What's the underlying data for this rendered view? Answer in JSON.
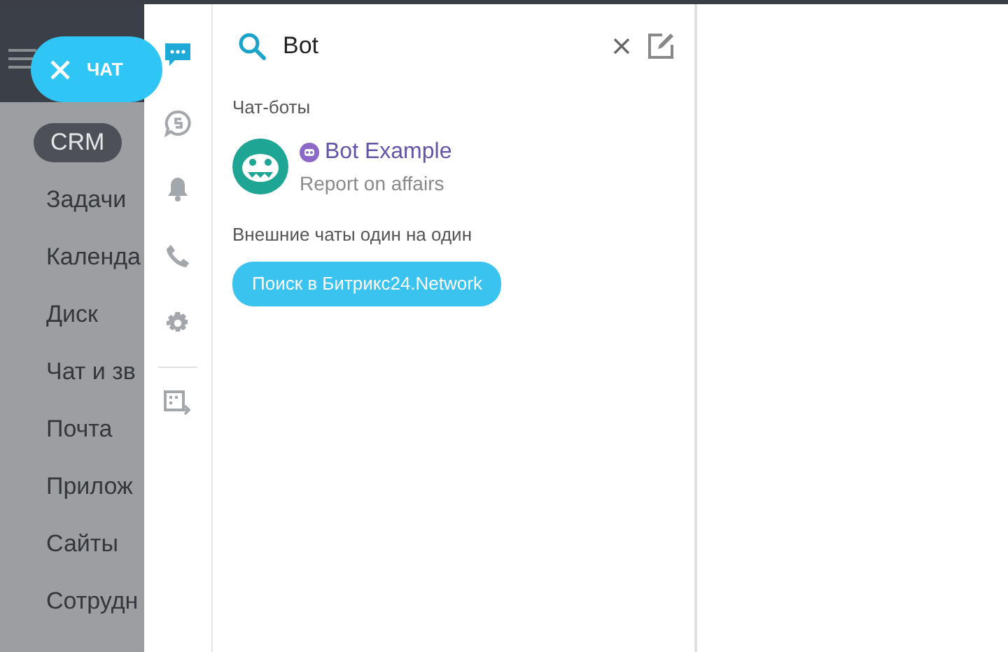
{
  "chat_button": {
    "label": "ЧАТ"
  },
  "menu": [
    {
      "label": "CRM",
      "selected": true
    },
    {
      "label": "Задачи",
      "selected": false
    },
    {
      "label": "Календа",
      "selected": false
    },
    {
      "label": "Диск",
      "selected": false
    },
    {
      "label": "Чат и зв",
      "selected": false
    },
    {
      "label": "Почта",
      "selected": false
    },
    {
      "label": "Прилож",
      "selected": false
    },
    {
      "label": "Сайты",
      "selected": false
    },
    {
      "label": "Сотрудн",
      "selected": false
    }
  ],
  "icon_bar": [
    {
      "kind": "chat",
      "selected": true
    },
    {
      "kind": "openlines",
      "selected": false
    },
    {
      "kind": "bell",
      "selected": false
    },
    {
      "kind": "phone",
      "selected": false
    },
    {
      "kind": "gear",
      "selected": false
    },
    {
      "kind": "divider"
    },
    {
      "kind": "export",
      "selected": false
    }
  ],
  "search": {
    "value": "Bot"
  },
  "sections": [
    {
      "title": "Чат-боты",
      "items": [
        {
          "name": "Bot Example",
          "subtitle": "Report on affairs"
        }
      ]
    },
    {
      "title": "Внешние чаты один на один",
      "button": "Поиск в Битрикс24.Network"
    }
  ]
}
